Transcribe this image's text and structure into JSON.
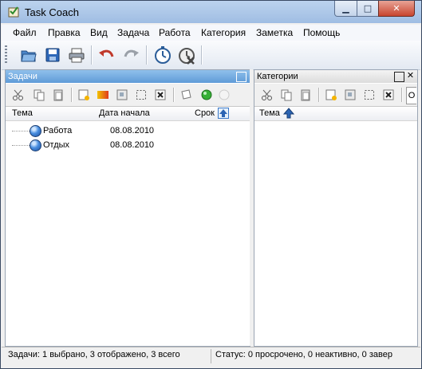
{
  "window": {
    "title": "Task Coach"
  },
  "menu": [
    "Файл",
    "Правка",
    "Вид",
    "Задача",
    "Работа",
    "Категория",
    "Заметка",
    "Помощь"
  ],
  "toolbar": {
    "icons": [
      "open-folder-icon",
      "save-icon",
      "print-icon",
      "undo-icon",
      "redo-icon",
      "start-timer-icon",
      "stop-timer-icon"
    ]
  },
  "tasks_panel": {
    "title": "Задачи",
    "columns": {
      "subject": "Тема",
      "start_date": "Дата начала",
      "due": "Срок"
    },
    "rows": [
      {
        "subject": "Работа",
        "start_date": "08.08.2010"
      },
      {
        "subject": "Отдых",
        "start_date": "08.08.2010"
      }
    ]
  },
  "categories_panel": {
    "title": "Категории",
    "columns": {
      "subject": "Тема"
    }
  },
  "status": {
    "left": "Задачи: 1 выбрано, 3 отображено, 3 всего",
    "right": "Статус: 0 просрочено, 0 неактивно, 0 завер"
  },
  "colors": {
    "panel_header_active": "#6ea9e2",
    "task_icon": "#2f74cf"
  }
}
